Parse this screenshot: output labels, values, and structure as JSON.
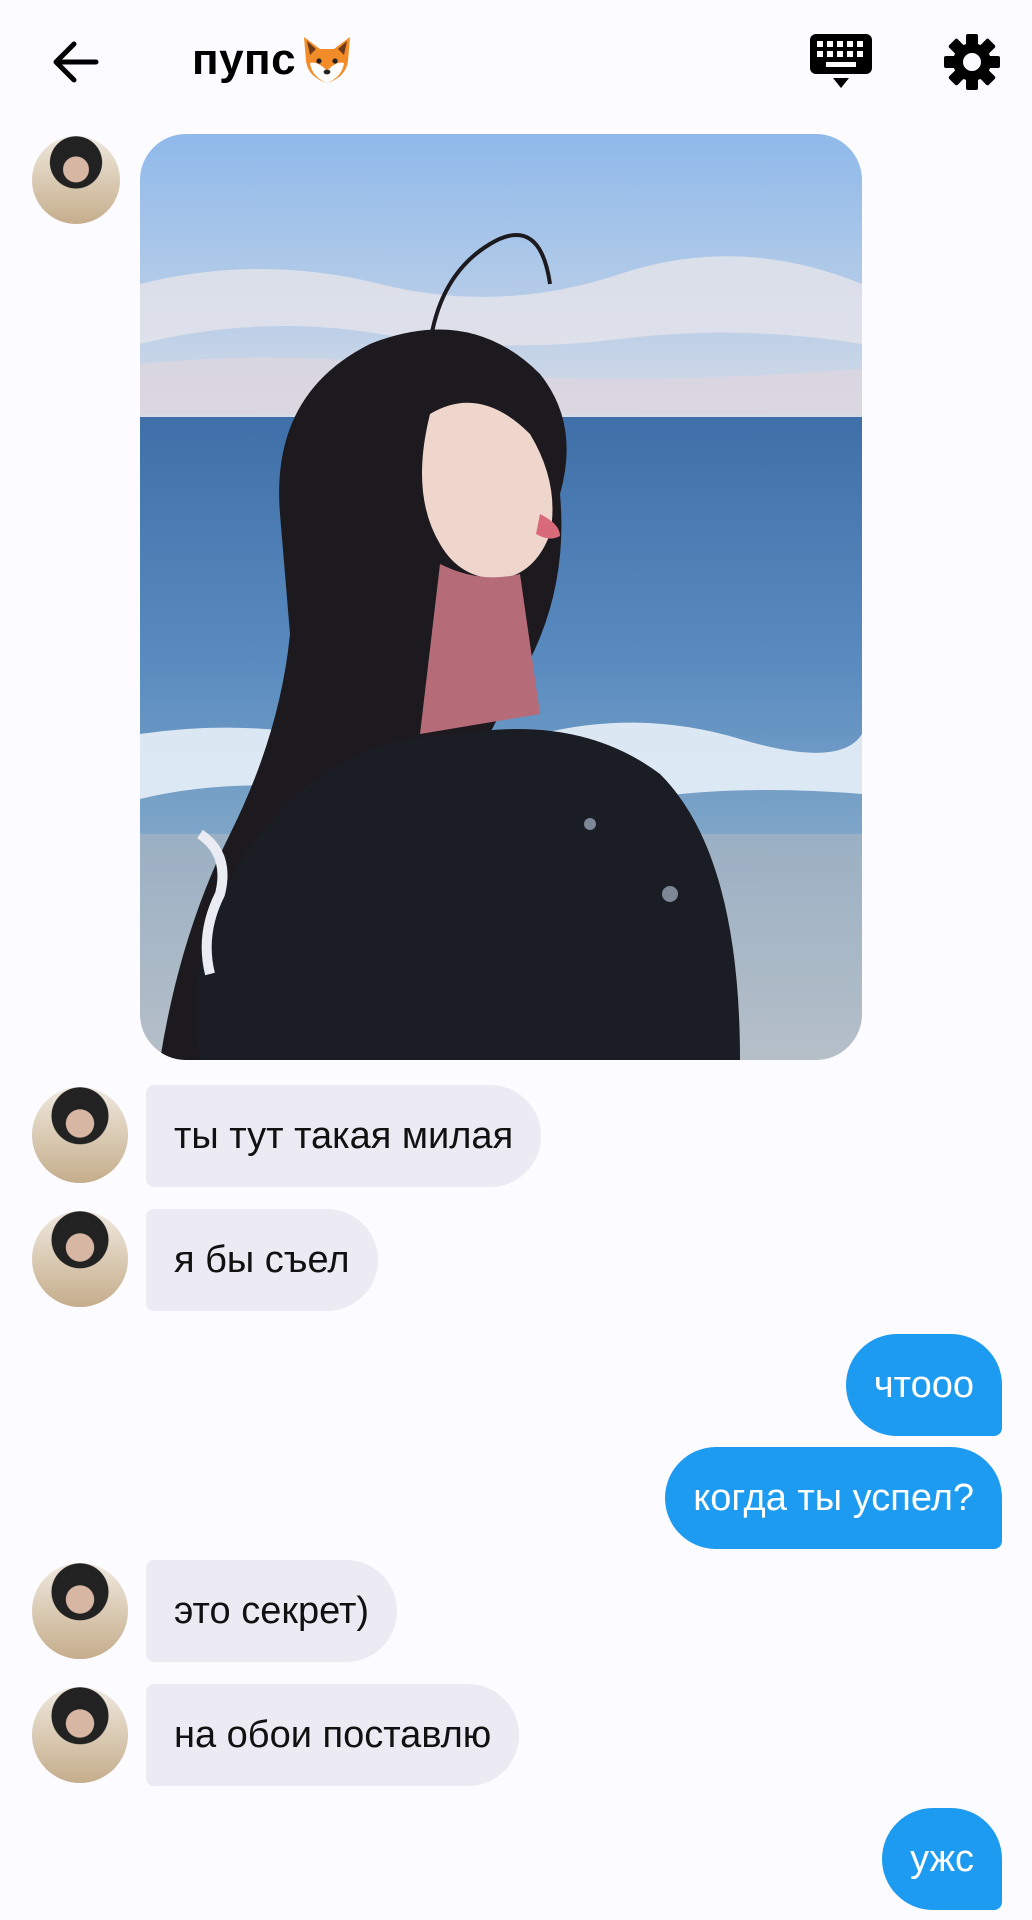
{
  "header": {
    "title": "пупс",
    "title_emoji": "fox-emoji",
    "back_icon": "arrow-left-icon",
    "keyboard_icon": "keyboard-icon",
    "settings_icon": "gear-icon"
  },
  "colors": {
    "incoming_bubble": "#eceaf2",
    "outgoing_bubble": "#1d9bf0",
    "background": "#fcfbff"
  },
  "messages": [
    {
      "id": "m0",
      "type": "image",
      "direction": "incoming",
      "content": "photo-woman-at-sea"
    },
    {
      "id": "m1",
      "type": "text",
      "direction": "incoming",
      "text": "ты тут такая милая"
    },
    {
      "id": "m2",
      "type": "text",
      "direction": "incoming",
      "text": "я бы съел"
    },
    {
      "id": "m3",
      "type": "text",
      "direction": "outgoing",
      "text": "чтооо"
    },
    {
      "id": "m4",
      "type": "text",
      "direction": "outgoing",
      "text": "когда ты успел?"
    },
    {
      "id": "m5",
      "type": "text",
      "direction": "incoming",
      "text": "это секрет)"
    },
    {
      "id": "m6",
      "type": "text",
      "direction": "incoming",
      "text": "на обои поставлю"
    },
    {
      "id": "m7",
      "type": "text",
      "direction": "outgoing",
      "text": "ужс"
    }
  ]
}
